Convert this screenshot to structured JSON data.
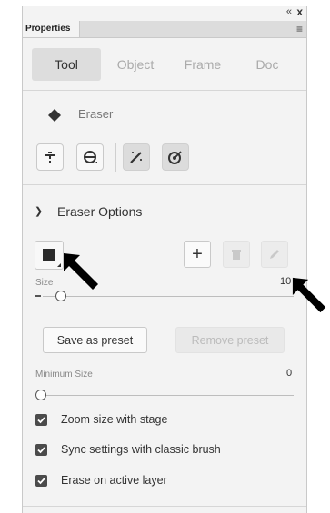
{
  "panel": {
    "title": "Properties",
    "collapse_glyph": "«",
    "close_glyph": "x",
    "menu_glyph": "≡"
  },
  "tabs": [
    {
      "label": "Tool",
      "active": true
    },
    {
      "label": "Object",
      "active": false
    },
    {
      "label": "Frame",
      "active": false
    },
    {
      "label": "Doc",
      "active": false
    }
  ],
  "tool": {
    "name": "Eraser",
    "icon": "eraser-icon"
  },
  "tool_modes": [
    {
      "icon": "faucet-icon",
      "selected": false
    },
    {
      "icon": "eraser-shape-icon",
      "selected": false
    },
    {
      "icon": "magic-wand-icon",
      "selected": true
    },
    {
      "icon": "target-icon",
      "selected": true
    }
  ],
  "eraser_options": {
    "title": "Eraser Options",
    "size_label": "Size",
    "size_value": "10",
    "size_level": 0.05,
    "add_glyph": "+",
    "save_preset": "Save as preset",
    "remove_preset": "Remove preset",
    "min_size_label": "Minimum Size",
    "min_size_value": "0",
    "min_size_level": 0.0
  },
  "checkboxes": [
    {
      "label": "Zoom size with stage",
      "checked": true
    },
    {
      "label": "Sync settings with classic brush",
      "checked": true
    },
    {
      "label": "Erase on active layer",
      "checked": true
    }
  ],
  "colors": {
    "panel_bg": "#f3f3f3",
    "active_tab_bg": "#dddddd",
    "checkbox": "#4b4b4b"
  }
}
